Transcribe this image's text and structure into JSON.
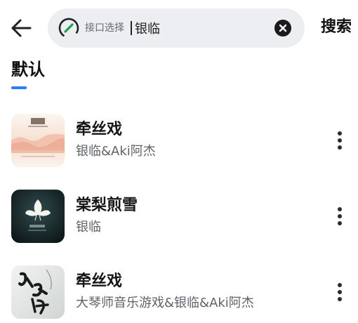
{
  "header": {
    "search": {
      "api_label": "接口选择",
      "query": "银临",
      "api_icon": "api-switch-icon",
      "clear_icon": "clear-icon"
    },
    "back_icon": "arrow-left-icon",
    "search_button_label": "搜索"
  },
  "tabs": [
    {
      "label": "默认",
      "active": true
    }
  ],
  "colors": {
    "accent": "#2a7ef6",
    "search_bg": "#eceef1",
    "api_icon_green": "#17a34a",
    "secondary_text": "#5f6368"
  },
  "songs": [
    {
      "title": "牵丝戏",
      "artist": "银临&Aki阿杰",
      "cover_icon": "album-cover-pastel"
    },
    {
      "title": "棠梨煎雪",
      "artist": "银临",
      "cover_icon": "album-cover-dark-flower"
    },
    {
      "title": "牵丝戏",
      "artist": "大琴师音乐游戏&银临&Aki阿杰",
      "cover_icon": "album-cover-calligraphy"
    }
  ]
}
